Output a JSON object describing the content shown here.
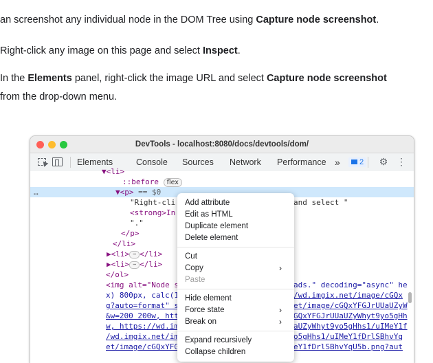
{
  "doc": {
    "line1": {
      "pre": "an screenshot any individual node in the DOM Tree using ",
      "strong": "Capture node screenshot",
      "post": "."
    },
    "line2": {
      "pre": "Right-click any image on this page and select ",
      "strong": "Inspect",
      "post": "."
    },
    "line3": {
      "pre": "In the ",
      "strong1": "Elements",
      "mid": " panel, right-click the image URL and select ",
      "strong2": "Capture node screenshot"
    },
    "line4": "from the drop-down menu."
  },
  "devtools": {
    "title": "DevTools - localhost:8080/docs/devtools/dom/",
    "tabs": [
      "Elements",
      "Console",
      "Sources",
      "Network",
      "Performance"
    ],
    "more_tabs": "»",
    "message_count": "2",
    "gear_icon": "gear-icon",
    "kebab": "⋮",
    "colors": {
      "close": "#ff5f57",
      "minimize": "#febc2e",
      "zoom": "#28c840",
      "highlight": "#cfe8fc"
    }
  },
  "code": {
    "l1": "▼<li>",
    "l2_pseudo": "::before",
    "l2_badge": "flex",
    "l3_dots": "…",
    "l3_tag": "▼<p>",
    "l3_eq": " == $0",
    "l4_a": "\"Right-cli",
    "l4_b": "and select \"",
    "l5_a": "<strong>In",
    "l6": "\".\"",
    "l7": "</p>",
    "l8": "</li>",
    "l9": "▶<li>",
    "l9_end": "</li>",
    "l10": "▶<li>",
    "l10_end": "</li>",
    "l11": "</ol>",
    "l12_a": "<img alt=\"Node s",
    "l12_b": "ads.\" decoding=\"async\" he",
    "l13_a": "x) 800px, calc(1",
    "l13_b": "/wd.imgix.net/image/cGQx",
    "l14_a": "g?auto=format\" s",
    "l14_b": "et/image/cGQxYFGJrUUaUZyW",
    "l15_a": "&w=200 200w, htt",
    "l15_b": "GQxYFGJrUUaUZyWhyt9yo5gHh",
    "l16_a": "w, https://wd.im",
    "l16_b": "aUZyWhyt9yo5gHhs1/uIMeY1f",
    "l17_a": "/wd.imgix.net/im",
    "l17_b": "o5gHhs1/uIMeY1fDrlSBhvYq",
    "l18_a": "et/image/cGQxYFG",
    "l18_b": "eY1fDrlSBhvYqU5b.png?aut"
  },
  "context_menu": {
    "add_attribute": "Add attribute",
    "edit_html": "Edit as HTML",
    "duplicate": "Duplicate element",
    "delete": "Delete element",
    "cut": "Cut",
    "copy": "Copy",
    "paste": "Paste",
    "hide": "Hide element",
    "force_state": "Force state",
    "break_on": "Break on",
    "expand": "Expand recursively",
    "collapse": "Collapse children",
    "submenu_arrow": "›"
  }
}
